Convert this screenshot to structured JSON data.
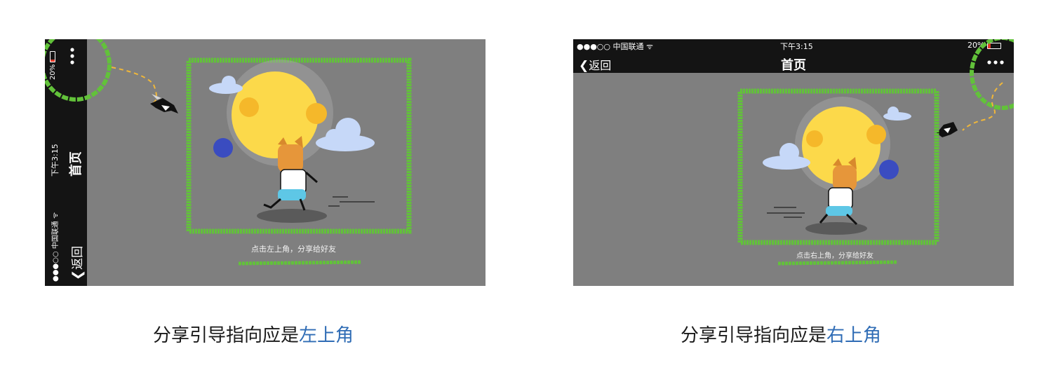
{
  "left_screen": {
    "status": {
      "signal_carrier": "●●●○○ 中国联通",
      "wifi_glyph": "ᯤ",
      "time": "下午3:15",
      "battery": "20%"
    },
    "nav": {
      "back_label": "返回",
      "title": "首页",
      "more_glyph": "•••"
    },
    "scene": {
      "hint_text": "点击左上角，分享给好友"
    }
  },
  "right_screen": {
    "status": {
      "signal_carrier": "●●●○○ 中国联通",
      "wifi_glyph": "ᯤ",
      "time": "下午3:15",
      "battery": "20%"
    },
    "nav": {
      "back_label": "返回",
      "title": "首页",
      "more_glyph": "•••"
    },
    "scene": {
      "hint_text": "点击右上角，分享给好友"
    }
  },
  "captions": {
    "left_prefix": "分享引导指向应是",
    "left_highlight": "左上角",
    "right_prefix": "分享引导指向应是",
    "right_highlight": "右上角"
  },
  "colors": {
    "screen_bg": "#7f7f7f",
    "bar_bg": "#141414",
    "accent_green": "#62c23a",
    "highlight_blue": "#2f6cb5",
    "moon_yellow": "#fcd94a",
    "moon_orange": "#f5b82a",
    "cloud": "#c6d8f8",
    "battery_red": "#e23a2a"
  },
  "icons": [
    "back-chevron-icon",
    "wifi-icon",
    "battery-icon",
    "more-icon",
    "magpie-icon",
    "moon-icon",
    "cloud-icon",
    "dog-runner-icon"
  ]
}
